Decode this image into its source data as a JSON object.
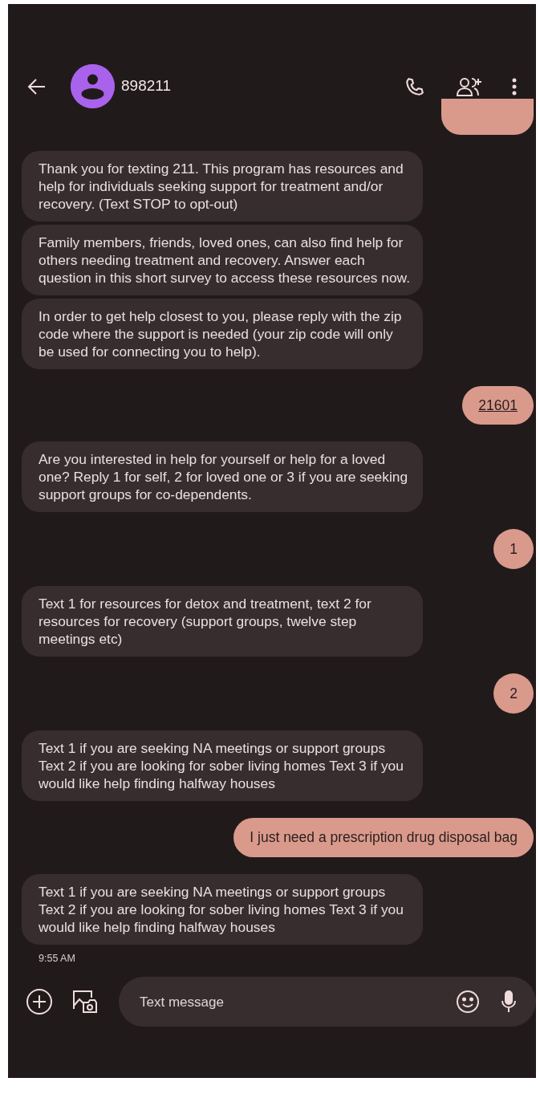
{
  "header": {
    "title": "898211"
  },
  "messages": [
    {
      "kind": "sent_cut"
    },
    {
      "kind": "received",
      "text": "Thank you for texting 211. This program has resources and help for individuals seeking support for treatment and/or recovery. (Text STOP to opt-out)"
    },
    {
      "kind": "received",
      "text": "Family members, friends, loved ones, can also find help for others needing treatment and recovery. Answer each question in this short survey to access these resources now."
    },
    {
      "kind": "received",
      "text": "In order to get help closest to you, please reply with the zip code where the support is needed (your zip code will only be used for connecting you to help)."
    },
    {
      "kind": "sent",
      "text": "21601",
      "link": true
    },
    {
      "kind": "received",
      "text": "Are you interested in help for yourself or help for a loved one? Reply 1 for self, 2 for loved one or 3 if you are seeking support groups for co-dependents."
    },
    {
      "kind": "sent",
      "text": "1"
    },
    {
      "kind": "received",
      "text": "Text 1 for resources for detox and treatment, text 2 for resources for recovery (support groups, twelve step meetings etc)"
    },
    {
      "kind": "sent",
      "text": "2"
    },
    {
      "kind": "received",
      "text": "Text 1 if you are seeking NA meetings or support groups Text 2 if you are looking for sober living homes Text 3 if you would like help finding halfway houses"
    },
    {
      "kind": "sent",
      "text": "I just need a prescription drug disposal bag"
    },
    {
      "kind": "received",
      "text": "Text 1 if you are seeking NA meetings or support groups Text 2 if you are looking for sober living homes Text 3 if you would like help finding halfway houses"
    }
  ],
  "timestamp": "9:55 AM",
  "composer": {
    "placeholder": "Text message"
  }
}
